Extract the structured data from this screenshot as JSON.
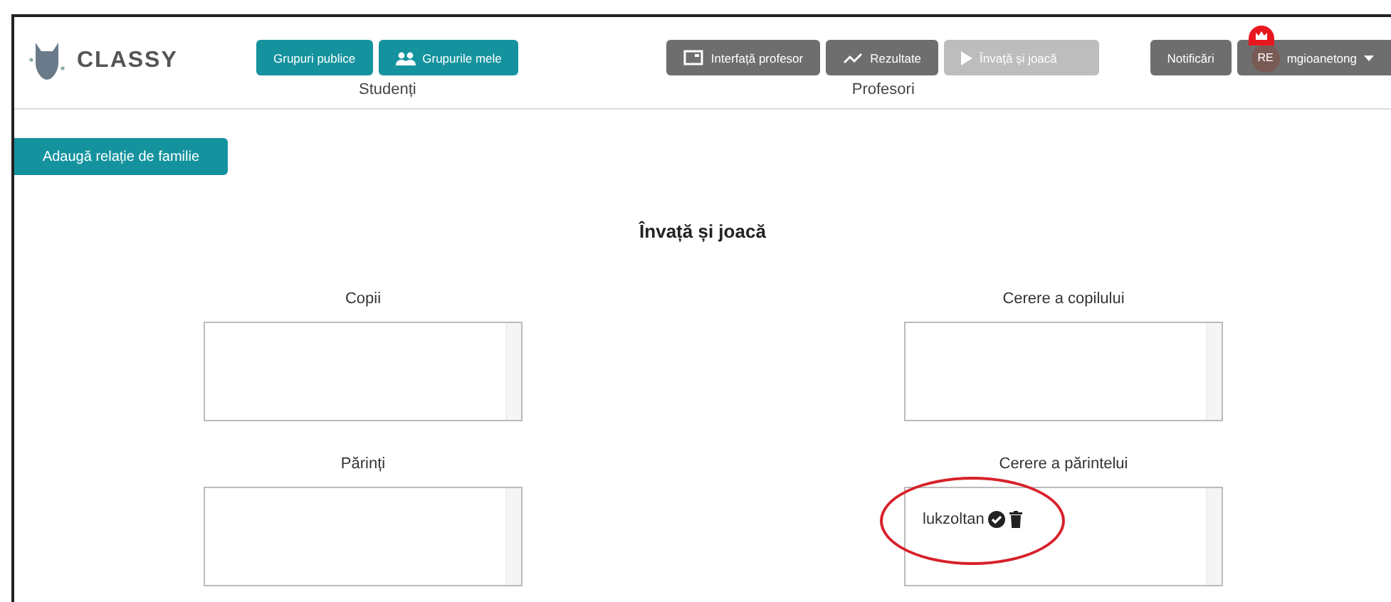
{
  "logo": {
    "text": "CLASSY"
  },
  "student_group": {
    "label": "Studenți",
    "buttons": [
      {
        "label": "Grupuri publice",
        "kind": "plain"
      },
      {
        "label": "Grupurile mele",
        "kind": "people"
      }
    ]
  },
  "teacher_group": {
    "label": "Profesori",
    "buttons": [
      {
        "label": "Interfață profesor",
        "kind": "board",
        "disabled": false
      },
      {
        "label": "Rezultate",
        "kind": "chart",
        "disabled": false
      },
      {
        "label": "Învață și joacă",
        "kind": "play",
        "disabled": true
      }
    ]
  },
  "notifications": {
    "label": "Notificări"
  },
  "user": {
    "initials": "RE",
    "name": "mgioanetong"
  },
  "add_button": {
    "label": "Adaugă relație de familie"
  },
  "title": "Învață și joacă",
  "panels": [
    {
      "label": "Copii"
    },
    {
      "label": "Cerere a copilului"
    },
    {
      "label": "Părinți"
    },
    {
      "label": "Cerere a părintelui",
      "items": [
        {
          "name": "lukzoltan"
        }
      ],
      "highlighted": true
    }
  ]
}
